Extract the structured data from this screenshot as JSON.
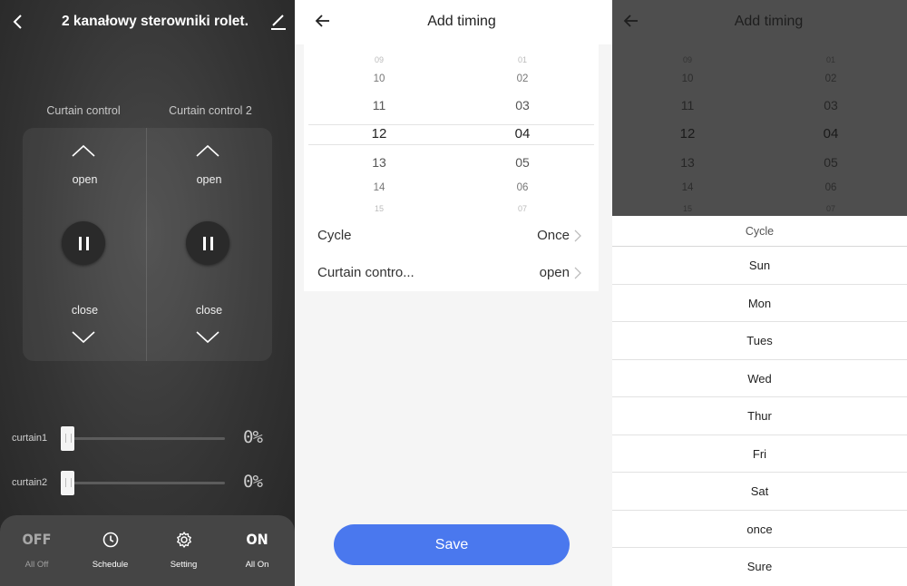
{
  "panel1": {
    "title": "2 kanałowy sterowniki rolet...",
    "channels": [
      {
        "label": "Curtain control",
        "open": "open",
        "close": "close"
      },
      {
        "label": "Curtain control 2",
        "open": "open",
        "close": "close"
      }
    ],
    "sliders": [
      {
        "label": "curtain1",
        "value_text": "0%",
        "value": 0
      },
      {
        "label": "curtain2",
        "value_text": "0%",
        "value": 0
      }
    ],
    "tabs": [
      {
        "icon_text": "OFF",
        "label": "All Off"
      },
      {
        "icon": "clock-icon",
        "label": "Schedule"
      },
      {
        "icon": "gear-icon",
        "label": "Setting"
      },
      {
        "icon_text": "ON",
        "label": "All On"
      }
    ]
  },
  "panel2": {
    "header": "Add timing",
    "hours": [
      "09",
      "10",
      "11",
      "12",
      "13",
      "14",
      "15"
    ],
    "minutes": [
      "01",
      "02",
      "03",
      "04",
      "05",
      "06",
      "07"
    ],
    "cycle_label": "Cycle",
    "cycle_value": "Once",
    "curtain_label": "Curtain contro...",
    "curtain_value": "open",
    "save": "Save"
  },
  "panel3": {
    "header": "Add timing",
    "sheet_title": "Cycle",
    "options": [
      "Sun",
      "Mon",
      "Tues",
      "Wed",
      "Thur",
      "Fri",
      "Sat",
      "once",
      "Sure"
    ]
  }
}
